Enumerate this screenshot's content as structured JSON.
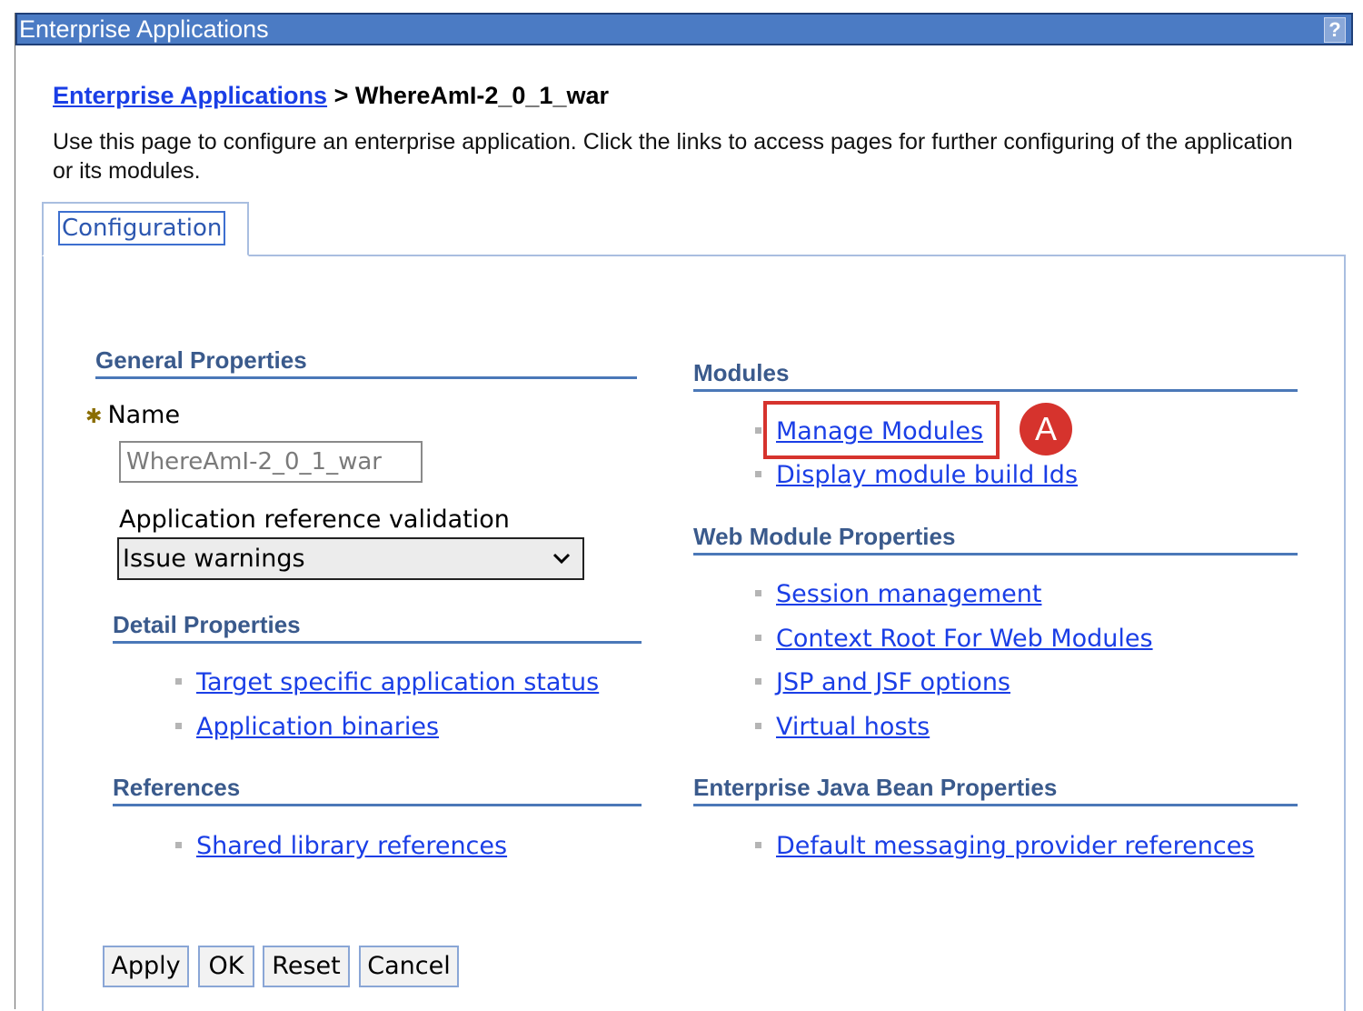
{
  "window": {
    "title": "Enterprise Applications",
    "help_label": "?"
  },
  "breadcrumb": {
    "parent": "Enterprise Applications",
    "separator": " > ",
    "current": "WhereAmI-2_0_1_war"
  },
  "description": "Use this page to configure an enterprise application. Click the links to access pages for further configuring of the application or its modules.",
  "tabs": [
    {
      "label": "Configuration"
    }
  ],
  "general_properties": {
    "title": "General Properties",
    "name_label": "Name",
    "required_marker": "✱",
    "name_value": "WhereAmI-2_0_1_war",
    "arv_label": "Application reference validation",
    "arv_selected": "Issue warnings"
  },
  "detail_properties": {
    "title": "Detail Properties",
    "links": [
      "Target specific application status",
      "Application binaries"
    ]
  },
  "references": {
    "title": "References",
    "links": [
      "Shared library references"
    ]
  },
  "modules": {
    "title": "Modules",
    "links": [
      "Manage Modules",
      "Display module build Ids"
    ]
  },
  "web_module_properties": {
    "title": "Web Module Properties",
    "links": [
      "Session management",
      "Context Root For Web Modules",
      "JSP and JSF options",
      "Virtual hosts"
    ]
  },
  "ejb_properties": {
    "title": "Enterprise Java Bean Properties",
    "links": [
      "Default messaging provider references"
    ]
  },
  "buttons": {
    "apply": "Apply",
    "ok": "OK",
    "reset": "Reset",
    "cancel": "Cancel"
  },
  "annotation": {
    "label": "A",
    "color": "#d6332d"
  }
}
